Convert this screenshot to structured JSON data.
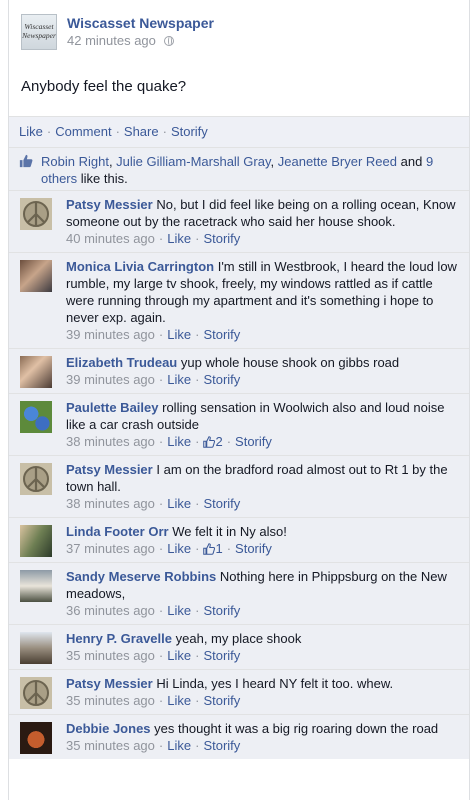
{
  "post": {
    "page_name": "Wiscasset Newspaper",
    "page_avatar_text": "Wiscasset Newspaper",
    "timestamp": "42 minutes ago",
    "text": "Anybody feel the quake?",
    "actions": [
      "Like",
      "Comment",
      "Share",
      "Storify"
    ],
    "likes": {
      "names": [
        "Robin Right",
        "Julie Gilliam-Marshall Gray",
        "Jeanette Bryer Reed"
      ],
      "and_word": "and",
      "others": "9 others",
      "suffix": "like this."
    }
  },
  "comment_actions": {
    "like": "Like",
    "storify": "Storify"
  },
  "comments": [
    {
      "author": "Patsy Messier",
      "text": "No, but I did feel like being on a rolling ocean, Know someone out by the racetrack who said her house shook.",
      "time": "40 minutes ago",
      "likes": "",
      "avatar": "peace"
    },
    {
      "author": "Monica Livia Carrington",
      "text": "I'm still in Westbrook, I heard the loud low rumble, my large tv shook, freely, my windows rattled as if cattle were running through my apartment and it's something i hope to never exp. again.",
      "time": "39 minutes ago",
      "likes": "",
      "avatar": "photo1"
    },
    {
      "author": "Elizabeth Trudeau",
      "text": "yup whole house shook on gibbs road",
      "time": "39 minutes ago",
      "likes": "",
      "avatar": "photo2"
    },
    {
      "author": "Paulette Bailey",
      "text": "rolling sensation in Woolwich also and loud noise like a car crash outside",
      "time": "38 minutes ago",
      "likes": "2",
      "avatar": "flowers"
    },
    {
      "author": "Patsy Messier",
      "text": "I am on the bradford road almost out to Rt 1 by the town hall.",
      "time": "38 minutes ago",
      "likes": "",
      "avatar": "peace"
    },
    {
      "author": "Linda Footer Orr",
      "text": "We felt it in Ny also!",
      "time": "37 minutes ago",
      "likes": "1",
      "avatar": "couple"
    },
    {
      "author": "Sandy Meserve Robbins",
      "text": "Nothing here in Phippsburg on the New meadows,",
      "time": "36 minutes ago",
      "likes": "",
      "avatar": "tent"
    },
    {
      "author": "Henry P. Gravelle",
      "text": "yeah, my place shook",
      "time": "35 minutes ago",
      "likes": "",
      "avatar": "hat"
    },
    {
      "author": "Patsy Messier",
      "text": "Hi Linda, yes I heard NY felt it too. whew.",
      "time": "35 minutes ago",
      "likes": "",
      "avatar": "peace"
    },
    {
      "author": "Debbie Jones",
      "text": "yes thought it was a big rig roaring down the road",
      "time": "35 minutes ago",
      "likes": "",
      "avatar": "monkey"
    }
  ],
  "colors": {
    "link": "#3b5998",
    "comment_bg": "#edeff4",
    "meta": "#90949c"
  }
}
